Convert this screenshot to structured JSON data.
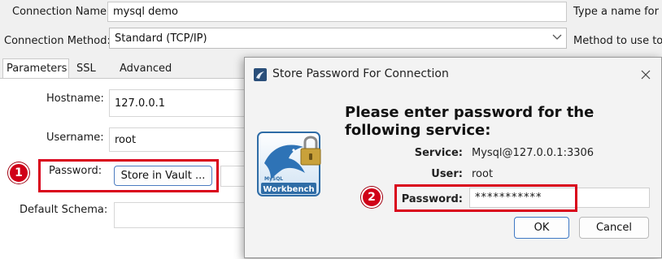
{
  "main": {
    "connection_name_label": "Connection Name:",
    "connection_name_value": "mysql demo",
    "connection_name_hint": "Type a name for th",
    "connection_method_label": "Connection Method:",
    "connection_method_value": "Standard (TCP/IP)",
    "connection_method_hint": "Method to use to c",
    "tabs": [
      {
        "label": "Parameters",
        "active": true
      },
      {
        "label": "SSL",
        "active": false
      },
      {
        "label": "Advanced",
        "active": false
      }
    ],
    "hostname_label": "Hostname:",
    "hostname_value": "127.0.0.1",
    "username_label": "Username:",
    "username_value": "root",
    "password_label": "Password:",
    "store_vault_button": "Store in Vault ...",
    "default_schema_label": "Default Schema:",
    "default_schema_value": ""
  },
  "annotations": {
    "badge1": "1",
    "badge2": "2",
    "highlight_color": "#d9001b"
  },
  "dialog": {
    "title": "Store Password For Connection",
    "close_icon": "close-icon",
    "heading_line1": "Please enter password for the",
    "heading_line2": "following service:",
    "service_label": "Service:",
    "service_value": "Mysql@127.0.0.1:3306",
    "user_label": "User:",
    "user_value": "root",
    "password_label": "Password:",
    "password_value": "***********",
    "logo_text_small": "MySQL",
    "logo_text": "Workbench",
    "ok_button": "OK",
    "cancel_button": "Cancel"
  }
}
